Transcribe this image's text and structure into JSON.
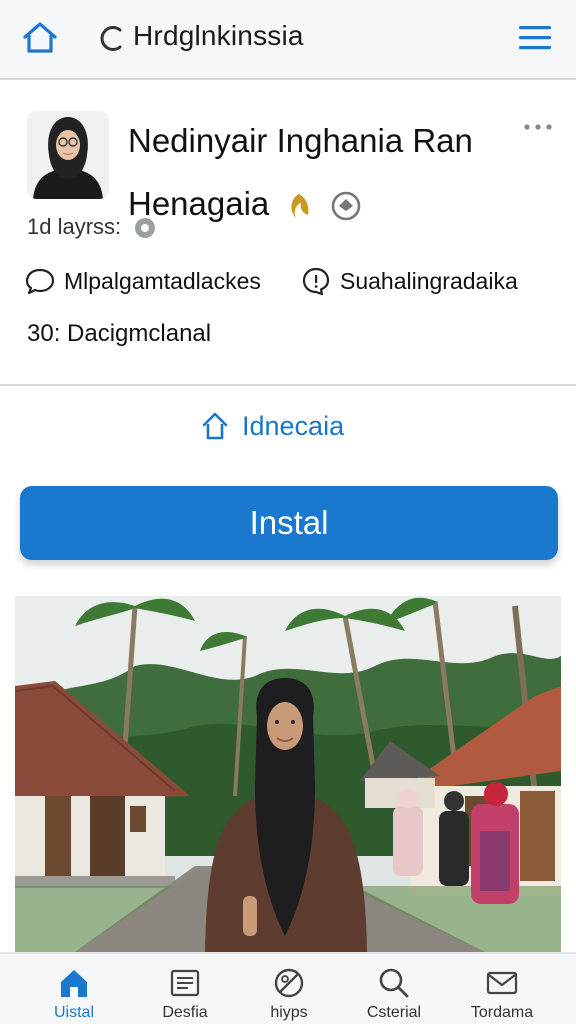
{
  "topbar": {
    "title": "Hrdglnkinssia",
    "home_icon": "home-icon",
    "reload_icon": "reload-icon",
    "menu_icon": "hamburger-menu-icon"
  },
  "profile": {
    "name": "Nedinyair Inghania Ran Henagaia",
    "meta": "1d layrss:",
    "stat1": "Mlpalgamtadlackes",
    "stat2": "Suahalingradaika",
    "count": "30: Dacigmclanal"
  },
  "sublink": "Idnecaia",
  "install_label": "Instal",
  "nav": [
    {
      "label": "Uistal",
      "icon": "home-icon",
      "active": true
    },
    {
      "label": "Desfia",
      "icon": "document-icon",
      "active": false
    },
    {
      "label": "hiyps",
      "icon": "no-entry-icon",
      "active": false
    },
    {
      "label": "Csterial",
      "icon": "search-icon",
      "active": false
    },
    {
      "label": "Tordama",
      "icon": "mail-icon",
      "active": false
    }
  ],
  "colors": {
    "accent": "#1a78cf",
    "topbar_bg": "#f6f7f8",
    "badge_gold": "#c99a1b"
  }
}
